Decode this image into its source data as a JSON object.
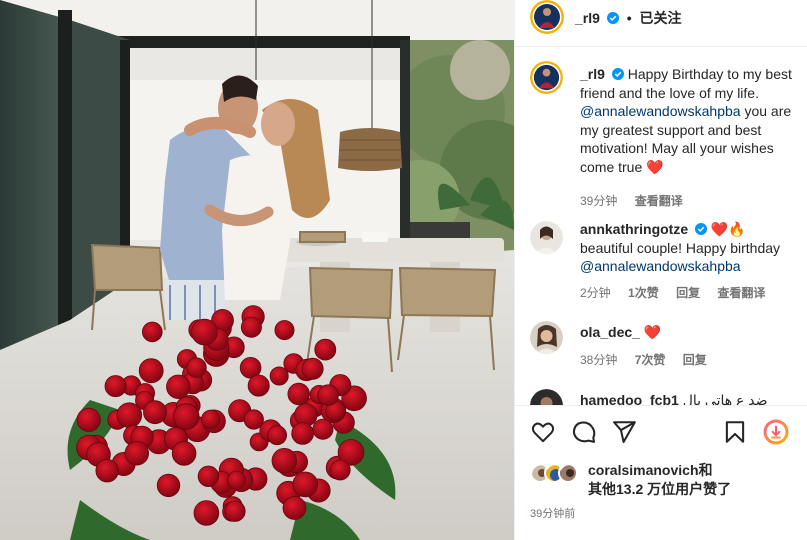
{
  "post": {
    "author": "_rl9",
    "follow_status": "已关注",
    "caption": {
      "text": "Happy Birthday to my best friend and the love of my life.",
      "mention": "@annalewandowskahpba",
      "text2": "you are my greatest support and best motivation! May all your wishes come true",
      "emoji": "❤️",
      "time": "39分钟",
      "translate": "查看翻译"
    },
    "comments": [
      {
        "user": "annkathringotze",
        "verified": true,
        "emojis": "❤️🔥",
        "text": "beautiful couple! Happy birthday",
        "mention": "@annalewandowskahpba",
        "time": "2分钟",
        "likes": "1次赞",
        "reply": "回复",
        "translate": "查看翻译"
      },
      {
        "user": "ola_dec_",
        "verified": false,
        "emojis": "❤️",
        "text": "",
        "time": "38分钟",
        "likes": "7次赞",
        "reply": "回复"
      },
      {
        "user": "hamedoo_fcb1",
        "verified": false,
        "text": "ضد ع هاتي بال"
      }
    ],
    "liked_by": {
      "user": "coralsimanovich",
      "suffix": "和",
      "others": "其他13.2 万位用户赞了"
    },
    "posted_time": "39分钟前"
  },
  "icons": {
    "like": "heart-icon",
    "comment": "comment-icon",
    "share": "share-icon",
    "save": "bookmark-icon",
    "download": "download-icon"
  },
  "colors": {
    "verified": "#0095f6",
    "heart": "#ed4956",
    "mention": "#00376b",
    "meta": "#737373",
    "download_gradient_start": "#ff5a8a",
    "download_gradient_end": "#ffb300"
  }
}
